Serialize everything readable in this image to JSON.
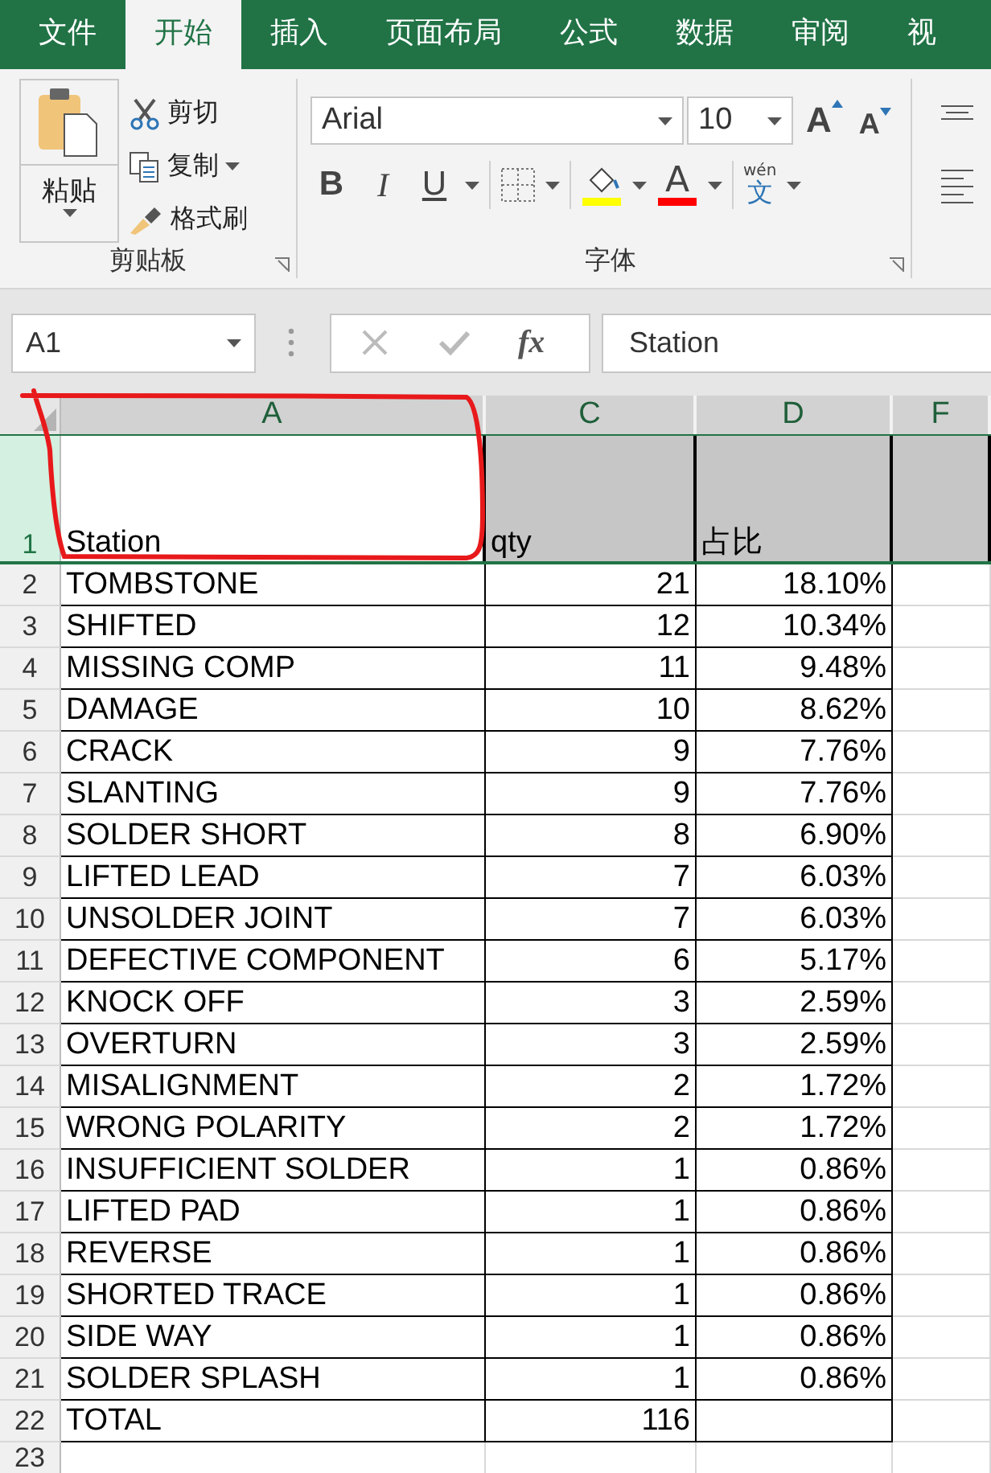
{
  "ribbon_tabs": [
    {
      "label": "文件",
      "selected": false
    },
    {
      "label": "开始",
      "selected": true
    },
    {
      "label": "插入",
      "selected": false
    },
    {
      "label": "页面布局",
      "selected": false
    },
    {
      "label": "公式",
      "selected": false
    },
    {
      "label": "数据",
      "selected": false
    },
    {
      "label": "审阅",
      "selected": false
    },
    {
      "label": "视",
      "selected": false
    }
  ],
  "clipboard_group": {
    "paste": "粘贴",
    "cut": "剪切",
    "copy": "复制",
    "format_painter": "格式刷",
    "label": "剪贴板"
  },
  "font_group": {
    "font": "Arial",
    "size": "10",
    "grow": "A",
    "shrink": "A",
    "bold": "B",
    "italic": "I",
    "underline": "U",
    "font_color": "A",
    "phonetic": "wén",
    "phonetic_char": "文",
    "label": "字体"
  },
  "formula_bar": {
    "name_box": "A1",
    "fx": "fx",
    "value": "Station"
  },
  "sheet": {
    "columns": [
      "A",
      "C",
      "D",
      "F"
    ],
    "rows": [
      {
        "number": "1",
        "kind": "header",
        "selected": true,
        "a": "Station",
        "c": "qty",
        "d": "占比"
      },
      {
        "number": "2",
        "kind": "data",
        "selected": false,
        "a": "TOMBSTONE",
        "c": "21",
        "d": "18.10%"
      },
      {
        "number": "3",
        "kind": "data",
        "selected": false,
        "a": "SHIFTED",
        "c": "12",
        "d": "10.34%"
      },
      {
        "number": "4",
        "kind": "data",
        "selected": false,
        "a": "MISSING COMP",
        "c": "11",
        "d": "9.48%"
      },
      {
        "number": "5",
        "kind": "data",
        "selected": false,
        "a": "DAMAGE",
        "c": "10",
        "d": "8.62%"
      },
      {
        "number": "6",
        "kind": "data",
        "selected": false,
        "a": "CRACK",
        "c": "9",
        "d": "7.76%"
      },
      {
        "number": "7",
        "kind": "data",
        "selected": false,
        "a": "SLANTING",
        "c": "9",
        "d": "7.76%"
      },
      {
        "number": "8",
        "kind": "data",
        "selected": false,
        "a": "SOLDER SHORT",
        "c": "8",
        "d": "6.90%"
      },
      {
        "number": "9",
        "kind": "data",
        "selected": false,
        "a": "LIFTED LEAD",
        "c": "7",
        "d": "6.03%"
      },
      {
        "number": "10",
        "kind": "data",
        "selected": false,
        "a": "UNSOLDER JOINT",
        "c": "7",
        "d": "6.03%"
      },
      {
        "number": "11",
        "kind": "data",
        "selected": false,
        "a": "DEFECTIVE COMPONENT",
        "c": "6",
        "d": "5.17%"
      },
      {
        "number": "12",
        "kind": "data",
        "selected": false,
        "a": "KNOCK OFF",
        "c": "3",
        "d": "2.59%"
      },
      {
        "number": "13",
        "kind": "data",
        "selected": false,
        "a": "OVERTURN",
        "c": "3",
        "d": "2.59%"
      },
      {
        "number": "14",
        "kind": "data",
        "selected": false,
        "a": "MISALIGNMENT",
        "c": "2",
        "d": "1.72%"
      },
      {
        "number": "15",
        "kind": "data",
        "selected": false,
        "a": "WRONG POLARITY",
        "c": "2",
        "d": "1.72%"
      },
      {
        "number": "16",
        "kind": "data",
        "selected": false,
        "a": "INSUFFICIENT SOLDER",
        "c": "1",
        "d": "0.86%"
      },
      {
        "number": "17",
        "kind": "data",
        "selected": false,
        "a": "LIFTED PAD",
        "c": "1",
        "d": "0.86%"
      },
      {
        "number": "18",
        "kind": "data",
        "selected": false,
        "a": "REVERSE",
        "c": "1",
        "d": "0.86%"
      },
      {
        "number": "19",
        "kind": "data",
        "selected": false,
        "a": "SHORTED TRACE",
        "c": "1",
        "d": "0.86%"
      },
      {
        "number": "20",
        "kind": "data",
        "selected": false,
        "a": "SIDE WAY",
        "c": "1",
        "d": "0.86%"
      },
      {
        "number": "21",
        "kind": "data",
        "selected": false,
        "a": "SOLDER SPLASH",
        "c": "1",
        "d": "0.86%"
      },
      {
        "number": "22",
        "kind": "data",
        "selected": false,
        "a": "TOTAL",
        "c": "116"
      },
      {
        "number": "23",
        "kind": "blank",
        "selected": false
      }
    ]
  }
}
